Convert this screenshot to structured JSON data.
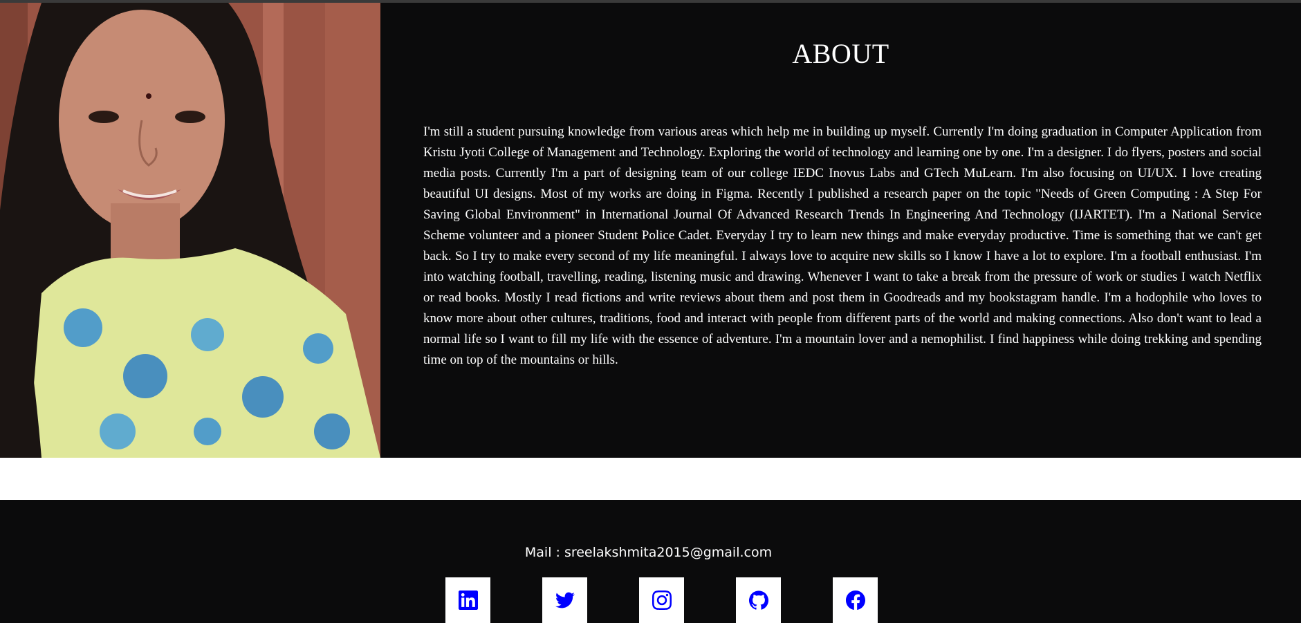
{
  "about": {
    "title": "ABOUT",
    "paragraph": "I'm still a student pursuing knowledge from various areas which help me in building up myself. Currently I'm doing graduation in Computer Application from Kristu Jyoti College of Management and Technology. Exploring the world of technology and learning one by one. I'm a designer. I do flyers, posters and social media posts. Currently I'm a part of designing team of our college IEDC Inovus Labs and GTech MuLearn. I'm also focusing on UI/UX. I love creating beautiful UI designs. Most of my works are doing in Figma. Recently I published a research paper on the topic \"Needs of Green Computing : A Step For Saving Global Environment\" in International Journal Of Advanced Research Trends In Engineering And Technology (IJARTET). I'm a National Service Scheme volunteer and a pioneer Student Police Cadet. Everyday I try to learn new things and make everyday productive. Time is something that we can't get back. So I try to make every second of my life meaningful. I always love to acquire new skills so I know I have a lot to explore. I'm a football enthusiast. I'm into watching football, travelling, reading, listening music and drawing. Whenever I want to take a break from the pressure of work or studies I watch Netflix or read books. Mostly I read fictions and write reviews about them and post them in Goodreads and my bookstagram handle. I'm a hodophile who loves to know more about other cultures, traditions, food and interact with people from different parts of the world and making connections. Also don't want to lead a normal life so I want to fill my life with the essence of adventure. I'm a mountain lover and a nemophilist. I find happiness while doing trekking and spending time on top of the mountains or hills."
  },
  "footer": {
    "mail_label": "Mail : ",
    "mail_value": "sreelakshmita2015@gmail.com",
    "socials": [
      {
        "name": "linkedin",
        "icon": "linkedin-icon"
      },
      {
        "name": "twitter",
        "icon": "twitter-icon"
      },
      {
        "name": "instagram",
        "icon": "instagram-icon"
      },
      {
        "name": "github",
        "icon": "github-icon"
      },
      {
        "name": "facebook",
        "icon": "facebook-icon"
      }
    ]
  },
  "colors": {
    "background": "#0b0b0c",
    "text": "#ffffff",
    "icon": "#0000ff",
    "band": "#ffffff"
  }
}
